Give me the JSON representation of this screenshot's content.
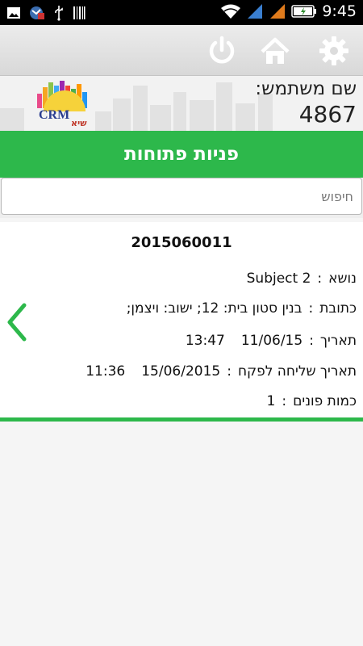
{
  "status_bar": {
    "time": "9:45",
    "icons": [
      "image-icon",
      "notification-icon",
      "usb-icon",
      "barcode-icon",
      "wifi-icon",
      "signal-icon",
      "signal-icon-2",
      "battery-charging-icon"
    ]
  },
  "action_bar": {
    "icons": [
      "power-icon",
      "home-icon",
      "gear-icon"
    ]
  },
  "header": {
    "user_label": "שם משתמש:",
    "user_value": "4867",
    "logo_text": "CRM",
    "logo_subtext": "שיא"
  },
  "title": "פניות פתוחות",
  "search": {
    "placeholder": "חיפוש",
    "value": ""
  },
  "card": {
    "id": "2015060011",
    "subject_label": "נושא",
    "subject_value": "Subject 2",
    "address_label": "כתובת",
    "address_value": "בנין סטון בית: 12; ישוב: ויצמן;",
    "date_label": "תאריך",
    "date_value": "11/06/15",
    "time_value": "13:47",
    "send_date_label": "תאריך שליחה לפקח",
    "send_date_value": "15/06/2015",
    "send_time_value": "11:36",
    "count_label": "כמות פונים",
    "count_value": "1"
  },
  "colors": {
    "accent": "#2db84b",
    "status_bar": "#000000",
    "action_bar": "#e2e2e2"
  }
}
